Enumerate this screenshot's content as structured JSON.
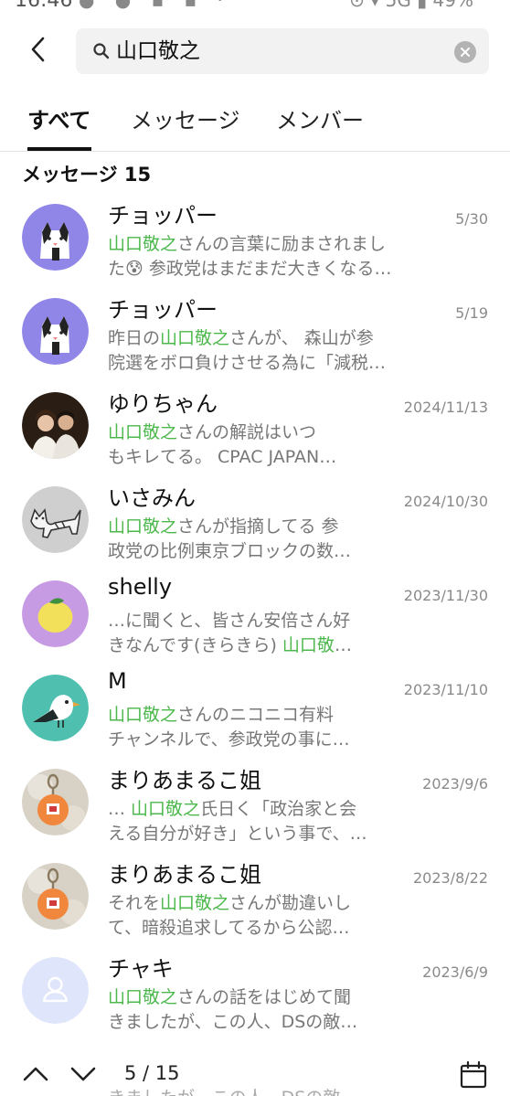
{
  "status_bar": {
    "time": "16:46",
    "icons": "● ● ▪ ▪ ·",
    "right": "⊙ ▾ 5G ▮ 49%"
  },
  "search": {
    "value": "山口敬之"
  },
  "tabs": [
    {
      "label": "すべて",
      "active": true
    },
    {
      "label": "メッセージ",
      "active": false
    },
    {
      "label": "メンバー",
      "active": false
    }
  ],
  "section": {
    "title": "メッセージ 15"
  },
  "messages": [
    {
      "name": "チョッパー",
      "date": "5/30",
      "avatar": "cat-icon",
      "line1": [
        {
          "t": "山口敬之",
          "hl": true
        },
        {
          "t": "さんの言葉に励まされまし",
          "hl": false
        }
      ],
      "line2": [
        {
          "t": "た😰 参政党はまだまだ大きくなる…",
          "hl": false
        }
      ]
    },
    {
      "name": "チョッパー",
      "date": "5/19",
      "avatar": "cat-icon",
      "line1": [
        {
          "t": "昨日の",
          "hl": false
        },
        {
          "t": "山口敬之",
          "hl": true
        },
        {
          "t": "さんが、 森山が参",
          "hl": false
        }
      ],
      "line2": [
        {
          "t": "院選をボロ負けさせる為に「減税…",
          "hl": false
        }
      ]
    },
    {
      "name": "ゆりちゃん",
      "date": "2024/11/13",
      "avatar": "photo-couple",
      "line1": [
        {
          "t": "山口敬之",
          "hl": true
        },
        {
          "t": "さんの解説はいつ",
          "hl": false
        }
      ],
      "line2": [
        {
          "t": "もキレてる。 CPAC JAPAN…",
          "hl": false
        }
      ]
    },
    {
      "name": "いさみん",
      "date": "2024/10/30",
      "avatar": "cat-drawing",
      "line1": [
        {
          "t": "山口敬之",
          "hl": true
        },
        {
          "t": "さんが指摘してる 参",
          "hl": false
        }
      ],
      "line2": [
        {
          "t": "政党の比例東京ブロックの数…",
          "hl": false
        }
      ]
    },
    {
      "name": "shelly",
      "date": "2023/11/30",
      "avatar": "lemon-icon",
      "line1": [
        {
          "t": "…に聞くと、皆さん安倍さん好",
          "hl": false
        }
      ],
      "line2": [
        {
          "t": "きなんです(きらきら) ",
          "hl": false
        },
        {
          "t": "山口敬",
          "hl": true
        },
        {
          "t": "…",
          "hl": false
        }
      ]
    },
    {
      "name": "M",
      "date": "2023/11/10",
      "avatar": "bird-icon",
      "line1": [
        {
          "t": "山口敬之",
          "hl": true
        },
        {
          "t": "さんのニコニコ有料",
          "hl": false
        }
      ],
      "line2": [
        {
          "t": "チャンネルで、参政党の事に…",
          "hl": false
        }
      ]
    },
    {
      "name": "まりあまるこ姐",
      "date": "2023/9/6",
      "avatar": "keychain-photo",
      "line1": [
        {
          "t": "… ",
          "hl": false
        },
        {
          "t": "山口敬之",
          "hl": true
        },
        {
          "t": "氏日く「政治家と会",
          "hl": false
        }
      ],
      "line2": [
        {
          "t": "える自分が好き」という事で、…",
          "hl": false
        }
      ]
    },
    {
      "name": "まりあまるこ姐",
      "date": "2023/8/22",
      "avatar": "keychain-photo",
      "line1": [
        {
          "t": "それを",
          "hl": false
        },
        {
          "t": "山口敬之",
          "hl": true
        },
        {
          "t": "さんが勘違いし",
          "hl": false
        }
      ],
      "line2": [
        {
          "t": "て、暗殺追求してるから公認…",
          "hl": false
        }
      ]
    },
    {
      "name": "チャキ",
      "date": "2023/6/9",
      "avatar": "default-user-icon",
      "line1": [
        {
          "t": "山口敬之",
          "hl": true
        },
        {
          "t": "さんの話をはじめて聞",
          "hl": false
        }
      ],
      "line2": [
        {
          "t": "きましたが、この人、DSの敵…",
          "hl": false
        }
      ]
    }
  ],
  "bottom": {
    "counter": "5 / 15",
    "ghost": "きましたが、この人、DSの敵…"
  },
  "colors": {
    "highlight": "#4cb84c",
    "avatar_purple": "#8f86e8",
    "avatar_teal": "#4fc0b0",
    "avatar_lilac": "#c79be3",
    "avatar_default": "#dfe6fb"
  }
}
